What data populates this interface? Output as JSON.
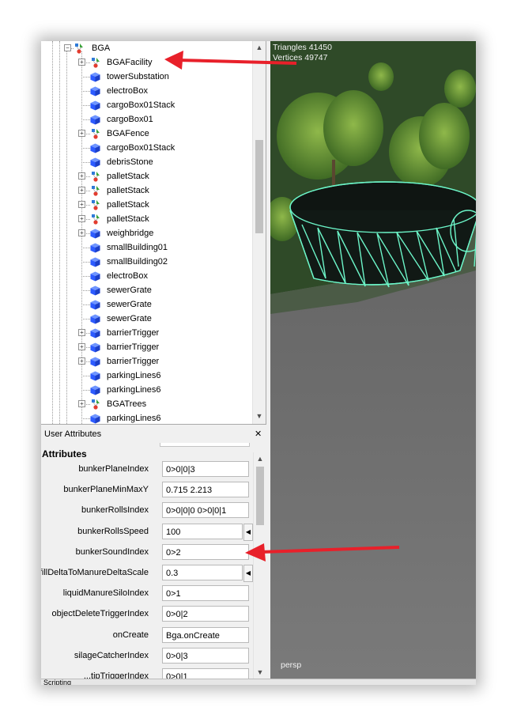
{
  "outliner": {
    "items": [
      {
        "label": "BGA",
        "icon": "group-icon",
        "expandable": true
      },
      {
        "label": "BGAFacility",
        "icon": "group-icon",
        "expandable": true
      },
      {
        "label": "towerSubstation",
        "icon": "mesh-cube-icon",
        "expandable": false
      },
      {
        "label": "electroBox",
        "icon": "mesh-cube-icon",
        "expandable": false
      },
      {
        "label": "cargoBox01Stack",
        "icon": "mesh-cube-icon",
        "expandable": false
      },
      {
        "label": "cargoBox01",
        "icon": "mesh-cube-icon",
        "expandable": false
      },
      {
        "label": "BGAFence",
        "icon": "group-icon",
        "expandable": true
      },
      {
        "label": "cargoBox01Stack",
        "icon": "mesh-cube-icon",
        "expandable": false
      },
      {
        "label": "debrisStone",
        "icon": "mesh-cube-icon",
        "expandable": false
      },
      {
        "label": "palletStack",
        "icon": "group-icon",
        "expandable": true
      },
      {
        "label": "palletStack",
        "icon": "group-icon",
        "expandable": true
      },
      {
        "label": "palletStack",
        "icon": "group-icon",
        "expandable": true
      },
      {
        "label": "palletStack",
        "icon": "group-icon",
        "expandable": true
      },
      {
        "label": "weighbridge",
        "icon": "mesh-cube-icon",
        "expandable": true
      },
      {
        "label": "smallBuilding01",
        "icon": "mesh-cube-icon",
        "expandable": false
      },
      {
        "label": "smallBuilding02",
        "icon": "mesh-cube-icon",
        "expandable": false
      },
      {
        "label": "electroBox",
        "icon": "mesh-cube-icon",
        "expandable": false
      },
      {
        "label": "sewerGrate",
        "icon": "mesh-cube-icon",
        "expandable": false
      },
      {
        "label": "sewerGrate",
        "icon": "mesh-cube-icon",
        "expandable": false
      },
      {
        "label": "sewerGrate",
        "icon": "mesh-cube-icon",
        "expandable": false
      },
      {
        "label": "barrierTrigger",
        "icon": "mesh-cube-icon",
        "expandable": true
      },
      {
        "label": "barrierTrigger",
        "icon": "mesh-cube-icon",
        "expandable": true
      },
      {
        "label": "barrierTrigger",
        "icon": "mesh-cube-icon",
        "expandable": true
      },
      {
        "label": "parkingLines6",
        "icon": "mesh-cube-icon",
        "expandable": false
      },
      {
        "label": "parkingLines6",
        "icon": "mesh-cube-icon",
        "expandable": false
      },
      {
        "label": "BGATrees",
        "icon": "group-icon",
        "expandable": true
      },
      {
        "label": "parkingLines6",
        "icon": "mesh-cube-icon",
        "expandable": false
      }
    ]
  },
  "user_attributes": {
    "panel_title": "User Attributes",
    "section_title": "Attributes",
    "close_glyph": "✕",
    "rows": [
      {
        "name": "bunkerPlaneIndex",
        "value": "0>0|0|3",
        "has_spinner": false
      },
      {
        "name": "bunkerPlaneMinMaxY",
        "value": "0.715 2.213",
        "has_spinner": false
      },
      {
        "name": "bunkerRollsIndex",
        "value": "0>0|0|0 0>0|0|1",
        "has_spinner": false
      },
      {
        "name": "bunkerRollsSpeed",
        "value": "100",
        "has_spinner": true
      },
      {
        "name": "bunkerSoundIndex",
        "value": "0>2",
        "has_spinner": false
      },
      {
        "name": "fillDeltaToManureDeltaScale",
        "value": "0.3",
        "has_spinner": true
      },
      {
        "name": "liquidManureSiloIndex",
        "value": "0>1",
        "has_spinner": false
      },
      {
        "name": "objectDeleteTriggerIndex",
        "value": "0>0|2",
        "has_spinner": false
      },
      {
        "name": "onCreate",
        "value": "Bga.onCreate",
        "has_spinner": false
      },
      {
        "name": "silageCatcherIndex",
        "value": "0>0|3",
        "has_spinner": false
      },
      {
        "name": "...tipTriggerIndex",
        "value": "0>0|1",
        "has_spinner": false
      }
    ]
  },
  "bottom_panel": {
    "label": "Scripting"
  },
  "viewport": {
    "triangles_label": "Triangles 41450",
    "vertices_label": "Vertices 49747",
    "camera_label": "persp"
  },
  "colors": {
    "annotation_arrow": "#e8202a",
    "wireframe": "#6cf5c8",
    "cube": "#2d5bff"
  }
}
